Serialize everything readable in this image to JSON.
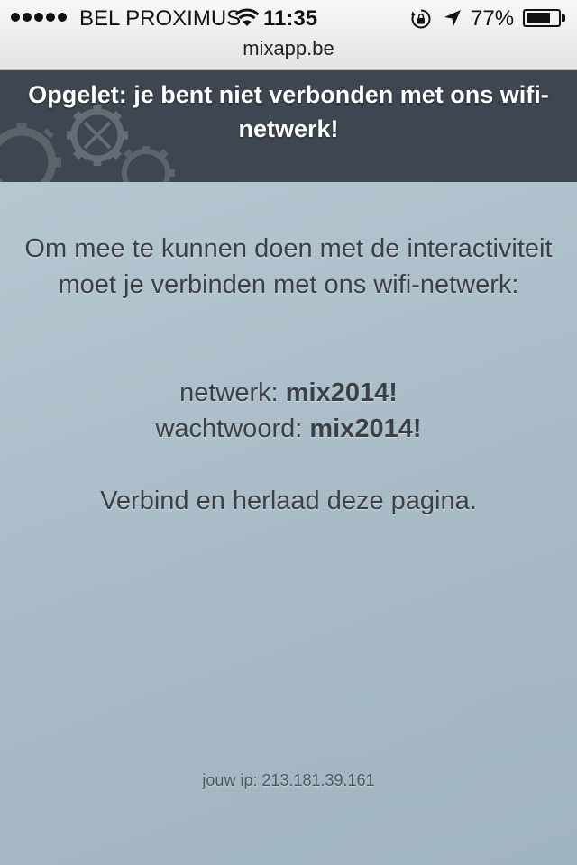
{
  "status_bar": {
    "signal_bars": 5,
    "carrier": "BEL PROXIMUS",
    "time": "11:35",
    "battery_percent_label": "77%",
    "battery_level": 0.77,
    "icons": [
      "wifi-icon",
      "rotation-lock-icon",
      "location-arrow-icon",
      "battery-icon"
    ]
  },
  "browser": {
    "url": "mixapp.be"
  },
  "banner": {
    "title": "Opgelet: je bent niet verbonden met ons wifi-netwerk!",
    "background_color": "#3e4751",
    "decoration": "gears-icon"
  },
  "main": {
    "message": "Om mee te kunnen doen met de interactiviteit moet je verbinden met ons wifi-netwerk:",
    "network_label": "netwerk:",
    "network_value": "mix2014!",
    "password_label": "wachtwoord:",
    "password_value": "mix2014!",
    "reload_text": "Verbind en herlaad deze pagina.",
    "ip_text": "jouw ip: 213.181.39.161"
  }
}
